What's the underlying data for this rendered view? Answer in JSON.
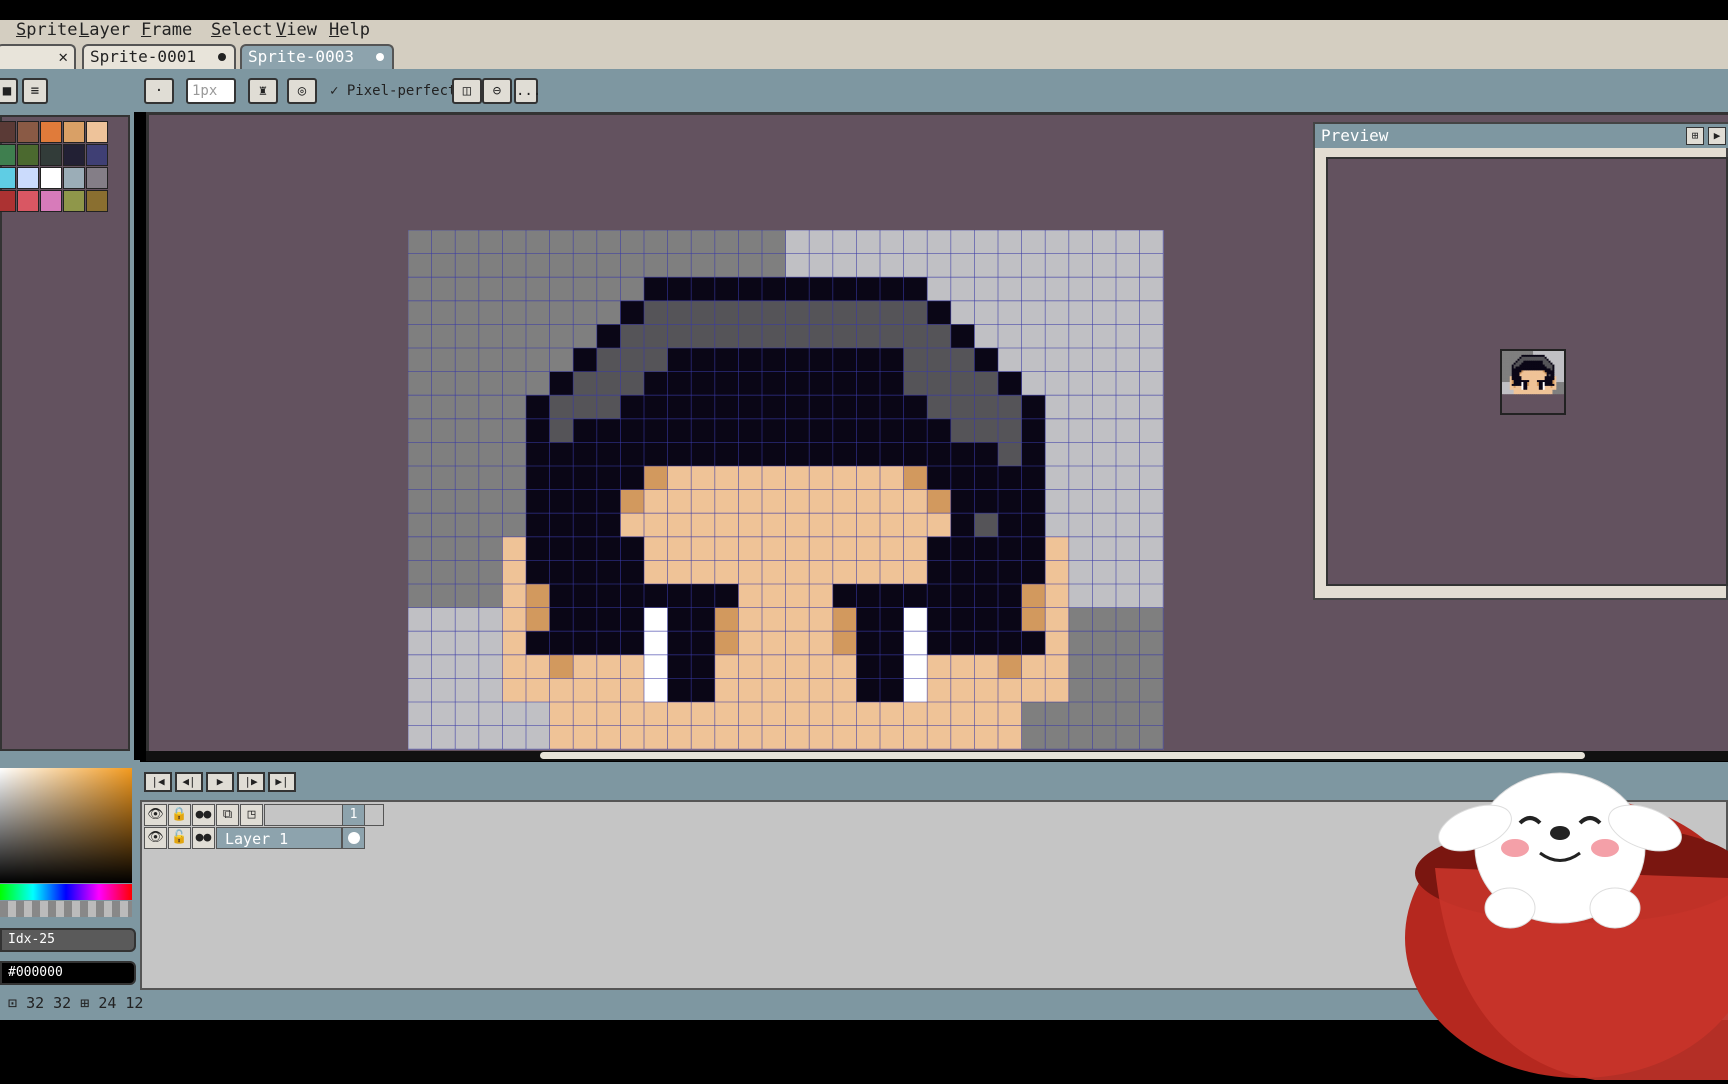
{
  "menu": {
    "items": [
      {
        "prefix": "",
        "accel": "S",
        "rest": "prite"
      },
      {
        "prefix": "",
        "accel": "L",
        "rest": "ayer"
      },
      {
        "prefix": "",
        "accel": "F",
        "rest": "rame"
      },
      {
        "prefix": "",
        "accel": "S",
        "rest": "elect"
      },
      {
        "prefix": "",
        "accel": "V",
        "rest": "iew"
      },
      {
        "prefix": "",
        "accel": "H",
        "rest": "elp"
      }
    ]
  },
  "tabs": [
    {
      "label": "",
      "state": "close"
    },
    {
      "label": "Sprite-0001",
      "state": "modified"
    },
    {
      "label": "Sprite-0003",
      "state": "modified-active"
    }
  ],
  "toolbar": {
    "brush_size_value": "1px",
    "pixel_perfect_label": "Pixel-perfect",
    "pixel_perfect_checked": true,
    "more_label": "..."
  },
  "palette": {
    "colors": [
      "#5a3a36",
      "#8a5a45",
      "#e07b3a",
      "#d9a066",
      "#eec39a",
      "#3f7f4f",
      "#4b692f",
      "#323c39",
      "#222034",
      "#3f3f74",
      "#5fcde4",
      "#cbdbfc",
      "#ffffff",
      "#9badb7",
      "#847e87",
      "#ac3232",
      "#d95763",
      "#d77bba",
      "#8f974a",
      "#8a6f30"
    ]
  },
  "color": {
    "index_label": "Idx-25",
    "hex_value": "#000000"
  },
  "preview": {
    "title": "Preview"
  },
  "timeline": {
    "frame_header": "1",
    "layers": [
      {
        "name": "Layer 1"
      }
    ]
  },
  "status": {
    "sprite_w": "32",
    "sprite_h": "32",
    "grid_w": "24",
    "grid_h": "12"
  },
  "sprite_colors": {
    "bg_dark": "#7f7f7f",
    "bg_light": "#c0c0c4",
    "hair": "#0a0616",
    "hair_gray": "#555458",
    "skin": "#efc397",
    "skin_shadow": "#d2995e",
    "eye_white": "#ffffff",
    "grid": "#3a3aa6"
  }
}
